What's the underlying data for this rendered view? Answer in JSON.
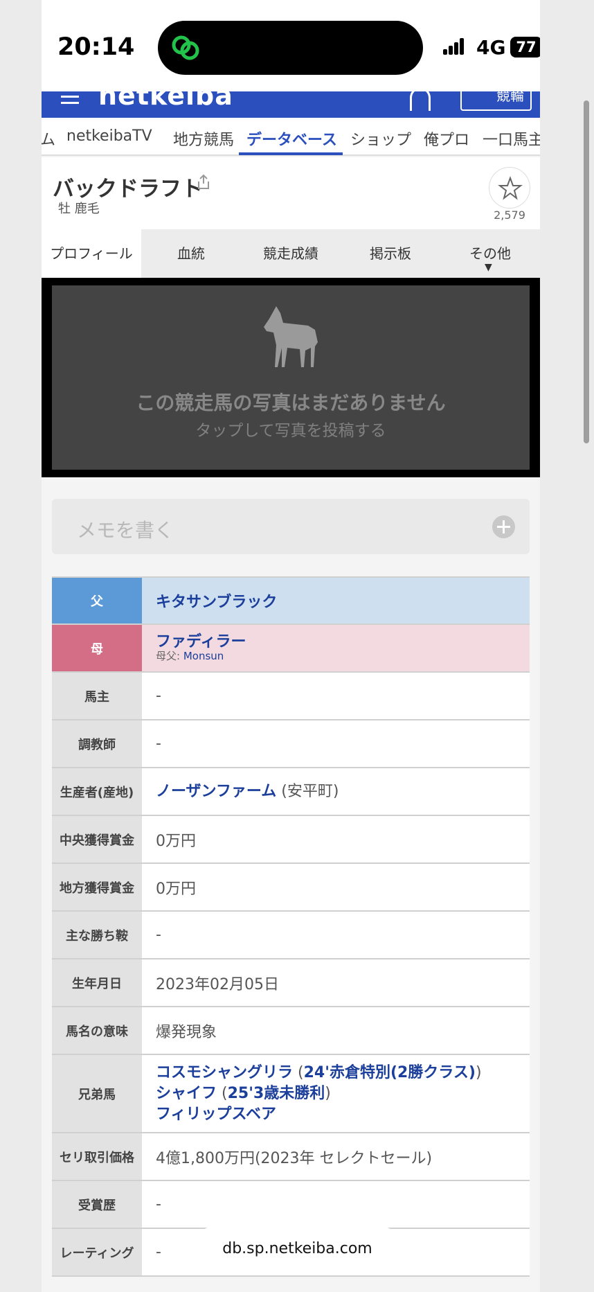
{
  "status_bar": {
    "time": "20:14",
    "network": "4G",
    "battery": "77"
  },
  "site": {
    "logo": "netkeiba",
    "keirin_label": "競輪"
  },
  "nav_tabs": [
    "ム",
    "netkeibaTV",
    "地方競馬",
    "データベース",
    "ショップ",
    "俺プロ",
    "一口馬主"
  ],
  "horse": {
    "name": "バックドラフト",
    "sex_color": "牡 鹿毛",
    "favorite_count": "2,579"
  },
  "sub_tabs": [
    "プロフィール",
    "血統",
    "競走成績",
    "掲示板",
    "その他"
  ],
  "sub_tab_more_marker": "▼",
  "photo": {
    "title": "この競走馬の写真はまだありません",
    "subtitle": "タップして写真を投稿する"
  },
  "memo": {
    "placeholder": "メモを書く"
  },
  "profile": {
    "sire_label": "父",
    "sire": "キタサンブラック",
    "dam_label": "母",
    "dam": "ファディラー",
    "dam_sire_label": "母父: ",
    "dam_sire": "Monsun",
    "owner_label": "馬主",
    "owner": "-",
    "trainer_label": "調教師",
    "trainer": "-",
    "breeder_label": "生産者(産地)",
    "breeder": "ノーザンファーム",
    "breeder_region": "(安平町)",
    "central_earnings_label": "中央獲得賞金",
    "central_earnings": "0万円",
    "local_earnings_label": "地方獲得賞金",
    "local_earnings": "0万円",
    "main_wins_label": "主な勝ち鞍",
    "main_wins": "-",
    "birthdate_label": "生年月日",
    "birthdate": "2023年02月05日",
    "name_meaning_label": "馬名の意味",
    "name_meaning": "爆発現象",
    "siblings_label": "兄弟馬",
    "siblings": [
      {
        "name": "コスモシャングリラ",
        "win": "24'赤倉特別(2勝クラス)"
      },
      {
        "name": "シャイフ",
        "win": "25'3歳未勝利"
      },
      {
        "name": "フィリップスベア",
        "win": ""
      }
    ],
    "auction_label": "セリ取引価格",
    "auction": "4億1,800万円(2023年 セレクトセール)",
    "awards_label": "受賞歴",
    "awards": "-",
    "rating_label": "レーティング",
    "rating": "-"
  },
  "url_bar": {
    "domain": "db.sp.netkeiba.com"
  }
}
